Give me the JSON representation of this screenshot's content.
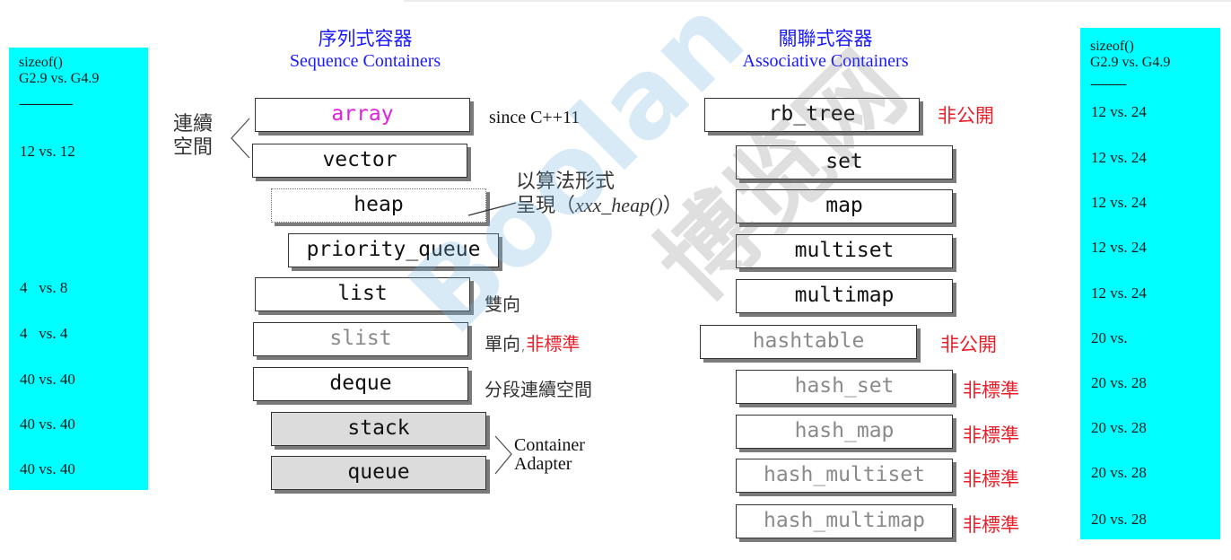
{
  "sizeof_left": {
    "header_line1": "sizeof()",
    "header_line2": "G2.9 vs. G4.9",
    "divider": "---------------",
    "rows": [
      "12 vs. 12",
      "4   vs. 8",
      "4   vs. 4",
      "40 vs. 40",
      "40 vs. 40",
      "40 vs. 40"
    ]
  },
  "sizeof_right": {
    "header_line1": "sizeof()",
    "header_line2": "G2.9 vs. G4.9",
    "divider": "----------",
    "rows": [
      "12 vs. 24",
      "12 vs. 24",
      "12 vs. 24",
      "12 vs. 24",
      "12 vs. 24",
      "20 vs.",
      "20 vs. 28",
      "20 vs. 28",
      "20 vs. 28",
      "20 vs. 28"
    ]
  },
  "sequence": {
    "title_zh": "序列式容器",
    "title_en": "Sequence Containers",
    "brace_label_line1": "連續",
    "brace_label_line2": "空間",
    "items": [
      {
        "name": "array",
        "note": "since C++11"
      },
      {
        "name": "vector"
      },
      {
        "name": "heap"
      },
      {
        "name": "priority_queue"
      },
      {
        "name": "list",
        "note": "雙向"
      },
      {
        "name": "slist",
        "note": "單向,",
        "note_red": "非標準"
      },
      {
        "name": "deque",
        "note": "分段連續空間"
      },
      {
        "name": "stack"
      },
      {
        "name": "queue"
      }
    ],
    "heap_note_line1": "以算法形式",
    "heap_note_line2_prefix": "呈現（",
    "heap_note_line2_italic": "xxx_heap()",
    "heap_note_line2_suffix": "）",
    "adapter_line1": "Container",
    "adapter_line2": "Adapter"
  },
  "associative": {
    "title_zh": "關聯式容器",
    "title_en": "Associative Containers",
    "items": [
      {
        "name": "rb_tree",
        "note": "非公開"
      },
      {
        "name": "set"
      },
      {
        "name": "map"
      },
      {
        "name": "multiset"
      },
      {
        "name": "multimap"
      },
      {
        "name": "hashtable",
        "note": "非公開"
      },
      {
        "name": "hash_set",
        "note": "非標準"
      },
      {
        "name": "hash_map",
        "note": "非標準"
      },
      {
        "name": "hash_multiset",
        "note": "非標準"
      },
      {
        "name": "hash_multimap",
        "note": "非標準"
      }
    ]
  },
  "colors": {
    "panel": "#00ffff",
    "title": "#1a1aff",
    "warning": "#e8202a",
    "array_highlight": "#e020e0",
    "adapter_fill": "#dcdcdc"
  },
  "watermark": {
    "text1": "Boolan",
    "text2": "博览网"
  }
}
